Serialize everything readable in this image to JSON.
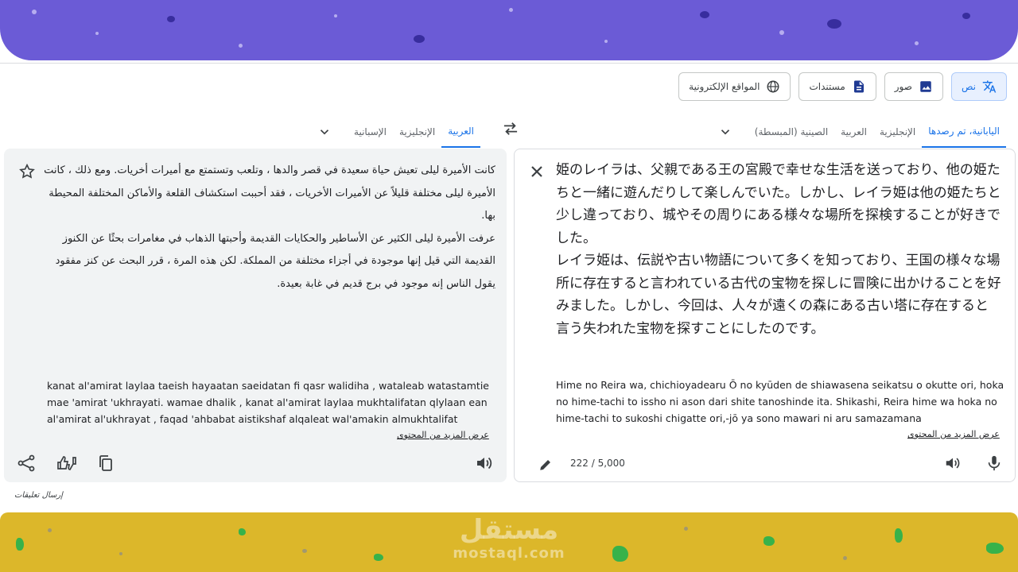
{
  "modes": [
    {
      "label": "نص",
      "icon": "translate-icon",
      "active": true
    },
    {
      "label": "صور",
      "icon": "image-icon",
      "active": false
    },
    {
      "label": "مستندات",
      "icon": "document-icon",
      "active": false
    },
    {
      "label": "المواقع الإلكترونية",
      "icon": "globe-icon",
      "active": false
    }
  ],
  "source_langs": {
    "detected": "اليابانية، تم رصدها",
    "items": [
      "الإنجليزية",
      "العربية",
      "الصينية (المبسطة)"
    ]
  },
  "target_langs": {
    "selected": "العربية",
    "items": [
      "الإنجليزية",
      "الإسبانية"
    ]
  },
  "source": {
    "paragraphs": [
      "姫のレイラは、父親である王の宮殿で幸せな生活を送っており、他の姫たちと一緒に遊んだりして楽しんでいた。しかし、レイラ姫は他の姫たちと少し違っており、城やその周りにある様々な場所を探検することが好きでした。",
      "レイラ姫は、伝説や古い物語について多くを知っており、王国の様々な場所に存在すると言われている古代の宝物を探しに冒険に出かけることを好みました。しかし、今回は、人々が遠くの森にある古い塔に存在すると言う失われた宝物を探すことにしたのです。"
    ],
    "romanization": "Hime no Reira wa, chichioyadearu Ō no kyūden de shiawasena seikatsu o okutte ori, hoka no hime-tachi to issho ni ason dari shite tanoshinde ita. Shikashi, Reira hime wa hoka no hime-tachi to sukoshi chigatte ori,-jō ya sono mawari ni aru samazamana",
    "more": "عرض المزيد من المحتوى",
    "counter": "222 / 5,000"
  },
  "target": {
    "paragraphs": [
      "كانت الأميرة ليلى تعيش حياة سعيدة في قصر والدها ، وتلعب وتستمتع مع أميرات أخريات. ومع ذلك ، كانت الأميرة ليلى مختلفة قليلاً عن الأميرات الأخريات ، فقد أحببت استكشاف القلعة والأماكن المختلفة المحيطة بها.",
      "عرفت الأميرة ليلى الكثير عن الأساطير والحكايات القديمة وأحبتها الذهاب في مغامرات بحثًا عن الكنوز القديمة التي قيل إنها موجودة في أجزاء مختلفة من المملكة. لكن هذه المرة ، قرر البحث عن كنز مفقود يقول الناس إنه موجود في برج قديم في غابة بعيدة."
    ],
    "romanization": "kanat al'amirat laylaa taeish hayaatan saeidatan fi qasr walidiha , wataleab watastamtie mae 'amirat 'ukhrayati. wamae dhalik , kanat al'amirat laylaa mukhtalifatan qlylaan ean al'amirat al'ukhrayat , faqad 'ahbabat aistikshaf alqaleat wal'amakin almukhtalifat",
    "more": "عرض المزيد من المحتوى"
  },
  "feedback": "إرسال تعليقات",
  "watermark": {
    "arabic": "مستقل",
    "latin": "mostaql.com"
  },
  "colors": {
    "accent": "#1a73e8",
    "top_band": "#6b5bd6",
    "bottom_band": "#dcb72a"
  }
}
